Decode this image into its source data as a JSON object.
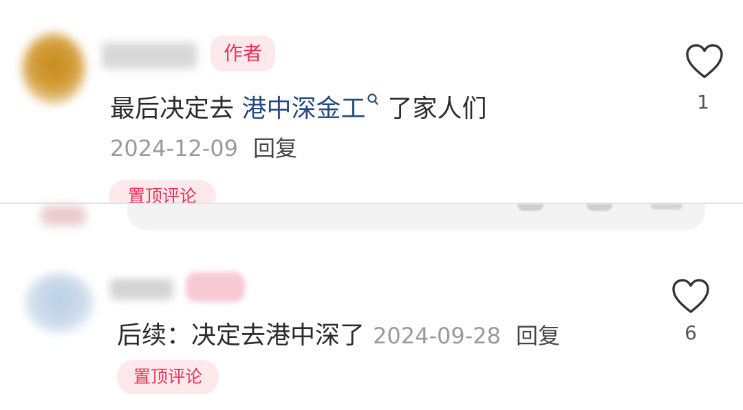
{
  "comment1": {
    "badge": "作者",
    "text_before": "最后决定去 ",
    "topic": "港中深金工",
    "topic_icon": "search-icon",
    "text_after": "了家人们",
    "date": "2024-12-09",
    "reply_label": "回复",
    "pin_label": "置顶评论",
    "like_count": "1",
    "like_icon": "heart-outline-icon"
  },
  "comment2": {
    "text": "后续：决定去港中深了",
    "date": "2024-09-28",
    "reply_label": "回复",
    "pin_label": "置顶评论",
    "like_count": "6",
    "like_icon": "heart-outline-icon"
  },
  "colors": {
    "accent_pink": "#e8335a",
    "badge_bg": "#fde8ec",
    "link_blue": "#264a7d",
    "meta_gray": "#9a9a9a"
  }
}
